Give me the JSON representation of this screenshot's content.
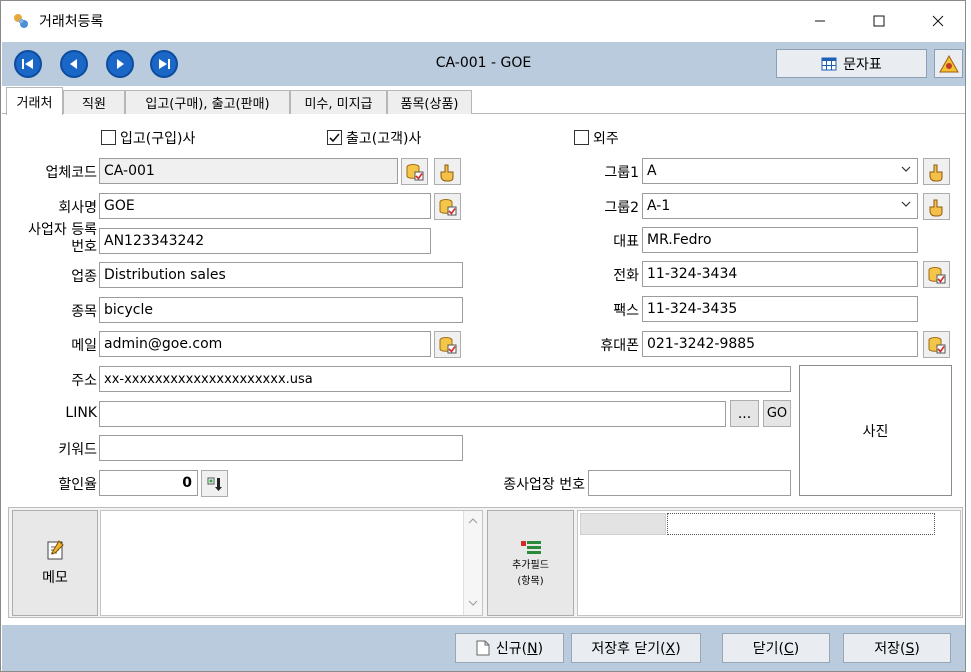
{
  "window": {
    "title": "거래처등록",
    "minimize_glyph": "—",
    "maximize_glyph": "☐",
    "close_glyph": "✕"
  },
  "toolbar": {
    "record_title": "CA-001 - GOE",
    "charmap_label": "문자표",
    "nav_icons": [
      "first-record-icon",
      "prev-record-icon",
      "next-record-icon",
      "last-record-icon"
    ]
  },
  "tabs": [
    {
      "label": "거래처",
      "active": true
    },
    {
      "label": "직원",
      "active": false
    },
    {
      "label": "입고(구매), 출고(판매)",
      "active": false
    },
    {
      "label": "미수, 미지급",
      "active": false
    },
    {
      "label": "품목(상품)",
      "active": false
    }
  ],
  "checkboxes": {
    "purchase": {
      "label": "입고(구입)사",
      "checked": false
    },
    "customer": {
      "label": "출고(고객)사",
      "checked": true
    },
    "outsource": {
      "label": "외주",
      "checked": false
    }
  },
  "form": {
    "code_label": "업체코드",
    "code_value": "CA-001",
    "company_label": "회사명",
    "company_value": "GOE",
    "bizno_label_line1": "사업자 등록",
    "bizno_label_line2": "번호",
    "bizno_value": "AN123343242",
    "industry_label": "업종",
    "industry_value": "Distribution sales",
    "item_label": "종목",
    "item_value": "bicycle",
    "email_label": "메일",
    "email_value": "admin@goe.com",
    "group1_label": "그룹1",
    "group1_value": "A",
    "group2_label": "그룹2",
    "group2_value": "A-1",
    "ceo_label": "대표",
    "ceo_value": "MR.Fedro",
    "phone_label": "전화",
    "phone_value": "11-324-3434",
    "fax_label": "팩스",
    "fax_value": "11-324-3435",
    "mobile_label": "휴대폰",
    "mobile_value": "021-3242-9885",
    "address_label": "주소",
    "address_value": "xx-xxxxxxxxxxxxxxxxxxxxx.usa",
    "link_label": "LINK",
    "link_value": "",
    "link_browse_label": "...",
    "link_go_label": "GO",
    "keyword_label": "키워드",
    "keyword_value": "",
    "discount_label": "할인율",
    "discount_value": "0",
    "branch_label": "종사업장 번호",
    "branch_value": "",
    "photo_label": "사진"
  },
  "memo": {
    "button_label": "메모",
    "text": ""
  },
  "extra": {
    "button_label_line1": "추가필드",
    "button_label_line2": "(항목)"
  },
  "footer": {
    "new_label": "신규(",
    "new_key": "N",
    "save_close_label": "저장후 닫기(",
    "save_close_key": "X",
    "close_label": "닫기(",
    "close_key": "C",
    "save_label": "저장(",
    "save_key": "S",
    "paren_close": ")"
  },
  "colors": {
    "toolbar_bg": "#b9cbdc",
    "nav_button": "#1a67c8",
    "readonly_field": "#f0f0f0"
  }
}
